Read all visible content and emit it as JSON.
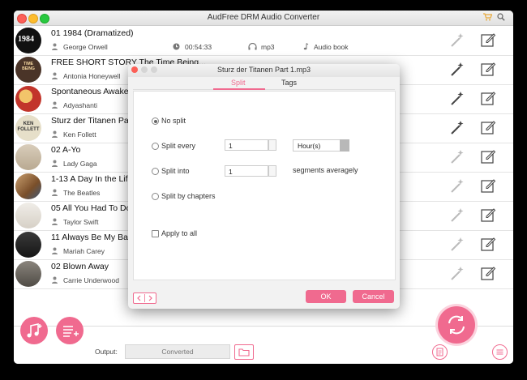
{
  "window": {
    "title": "AudFree DRM Audio Converter"
  },
  "tracks": [
    {
      "title": "01 1984 (Dramatized)",
      "artist": "George Orwell",
      "duration": "00:54:33",
      "format": "mp3",
      "type": "Audio book",
      "cover_color": "#111111",
      "cover_text": "1984"
    },
    {
      "title": "FREE SHORT STORY The Time Being...",
      "artist": "Antonia Honeywell",
      "cover_color": "#4a3428",
      "cover_text": "TIME BEING"
    },
    {
      "title": "Spontaneous Awaken",
      "artist": "Adyashanti",
      "cover_color": "#c2352b",
      "cover_text": ""
    },
    {
      "title": "Sturz der Titanen Pa",
      "artist": "Ken Follett",
      "cover_color": "#e6dfc9",
      "cover_text": "KEN FOLLETT"
    },
    {
      "title": "02 A-Yo",
      "artist": "Lady Gaga",
      "cover_color": "#cfc2b0",
      "cover_text": ""
    },
    {
      "title": "1-13 A Day In the Lif",
      "artist": "The Beatles",
      "cover_color": "#9b6b3f",
      "cover_text": ""
    },
    {
      "title": "05 All You Had To Do",
      "artist": "Taylor Swift",
      "cover_color": "#e9e6e0",
      "cover_text": ""
    },
    {
      "title": "11 Always Be My Bab",
      "artist": "Mariah Carey",
      "cover_color": "#2c2c2c",
      "cover_text": ""
    },
    {
      "title": "02 Blown Away",
      "artist": "Carrie Underwood",
      "cover_color": "#6e6a63",
      "cover_text": ""
    }
  ],
  "bottom": {
    "output_label": "Output:",
    "output_value": "Converted"
  },
  "dialog": {
    "title": "Sturz der Titanen Part 1.mp3",
    "tabs": [
      {
        "label": "Split",
        "active": true
      },
      {
        "label": "Tags",
        "active": false
      }
    ],
    "options": {
      "no_split": "No split",
      "split_every": "Split every",
      "split_every_value": "1",
      "split_every_unit": "Hour(s)",
      "split_into": "Split into",
      "split_into_value": "1",
      "segments_label": "segments averagely",
      "split_by_chapters": "Split by chapters",
      "apply_to_all": "Apply to all"
    },
    "ok_label": "OK",
    "cancel_label": "Cancel"
  },
  "colors": {
    "accent": "#f06a8f",
    "accent_light": "#fbd3de"
  }
}
